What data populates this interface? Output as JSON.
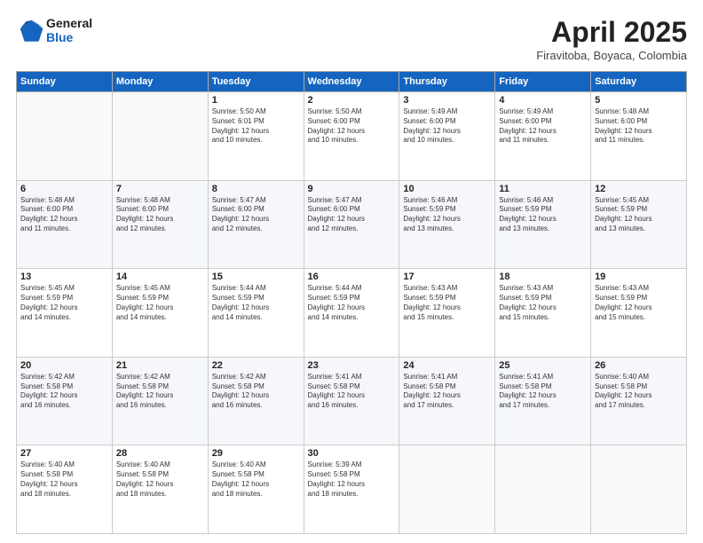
{
  "header": {
    "logo_line1": "General",
    "logo_line2": "Blue",
    "month": "April 2025",
    "location": "Firavitoba, Boyaca, Colombia"
  },
  "weekdays": [
    "Sunday",
    "Monday",
    "Tuesday",
    "Wednesday",
    "Thursday",
    "Friday",
    "Saturday"
  ],
  "weeks": [
    [
      {
        "day": "",
        "text": ""
      },
      {
        "day": "",
        "text": ""
      },
      {
        "day": "1",
        "text": "Sunrise: 5:50 AM\nSunset: 6:01 PM\nDaylight: 12 hours\nand 10 minutes."
      },
      {
        "day": "2",
        "text": "Sunrise: 5:50 AM\nSunset: 6:00 PM\nDaylight: 12 hours\nand 10 minutes."
      },
      {
        "day": "3",
        "text": "Sunrise: 5:49 AM\nSunset: 6:00 PM\nDaylight: 12 hours\nand 10 minutes."
      },
      {
        "day": "4",
        "text": "Sunrise: 5:49 AM\nSunset: 6:00 PM\nDaylight: 12 hours\nand 11 minutes."
      },
      {
        "day": "5",
        "text": "Sunrise: 5:48 AM\nSunset: 6:00 PM\nDaylight: 12 hours\nand 11 minutes."
      }
    ],
    [
      {
        "day": "6",
        "text": "Sunrise: 5:48 AM\nSunset: 6:00 PM\nDaylight: 12 hours\nand 11 minutes."
      },
      {
        "day": "7",
        "text": "Sunrise: 5:48 AM\nSunset: 6:00 PM\nDaylight: 12 hours\nand 12 minutes."
      },
      {
        "day": "8",
        "text": "Sunrise: 5:47 AM\nSunset: 6:00 PM\nDaylight: 12 hours\nand 12 minutes."
      },
      {
        "day": "9",
        "text": "Sunrise: 5:47 AM\nSunset: 6:00 PM\nDaylight: 12 hours\nand 12 minutes."
      },
      {
        "day": "10",
        "text": "Sunrise: 5:46 AM\nSunset: 5:59 PM\nDaylight: 12 hours\nand 13 minutes."
      },
      {
        "day": "11",
        "text": "Sunrise: 5:46 AM\nSunset: 5:59 PM\nDaylight: 12 hours\nand 13 minutes."
      },
      {
        "day": "12",
        "text": "Sunrise: 5:45 AM\nSunset: 5:59 PM\nDaylight: 12 hours\nand 13 minutes."
      }
    ],
    [
      {
        "day": "13",
        "text": "Sunrise: 5:45 AM\nSunset: 5:59 PM\nDaylight: 12 hours\nand 14 minutes."
      },
      {
        "day": "14",
        "text": "Sunrise: 5:45 AM\nSunset: 5:59 PM\nDaylight: 12 hours\nand 14 minutes."
      },
      {
        "day": "15",
        "text": "Sunrise: 5:44 AM\nSunset: 5:59 PM\nDaylight: 12 hours\nand 14 minutes."
      },
      {
        "day": "16",
        "text": "Sunrise: 5:44 AM\nSunset: 5:59 PM\nDaylight: 12 hours\nand 14 minutes."
      },
      {
        "day": "17",
        "text": "Sunrise: 5:43 AM\nSunset: 5:59 PM\nDaylight: 12 hours\nand 15 minutes."
      },
      {
        "day": "18",
        "text": "Sunrise: 5:43 AM\nSunset: 5:59 PM\nDaylight: 12 hours\nand 15 minutes."
      },
      {
        "day": "19",
        "text": "Sunrise: 5:43 AM\nSunset: 5:59 PM\nDaylight: 12 hours\nand 15 minutes."
      }
    ],
    [
      {
        "day": "20",
        "text": "Sunrise: 5:42 AM\nSunset: 5:58 PM\nDaylight: 12 hours\nand 16 minutes."
      },
      {
        "day": "21",
        "text": "Sunrise: 5:42 AM\nSunset: 5:58 PM\nDaylight: 12 hours\nand 16 minutes."
      },
      {
        "day": "22",
        "text": "Sunrise: 5:42 AM\nSunset: 5:58 PM\nDaylight: 12 hours\nand 16 minutes."
      },
      {
        "day": "23",
        "text": "Sunrise: 5:41 AM\nSunset: 5:58 PM\nDaylight: 12 hours\nand 16 minutes."
      },
      {
        "day": "24",
        "text": "Sunrise: 5:41 AM\nSunset: 5:58 PM\nDaylight: 12 hours\nand 17 minutes."
      },
      {
        "day": "25",
        "text": "Sunrise: 5:41 AM\nSunset: 5:58 PM\nDaylight: 12 hours\nand 17 minutes."
      },
      {
        "day": "26",
        "text": "Sunrise: 5:40 AM\nSunset: 5:58 PM\nDaylight: 12 hours\nand 17 minutes."
      }
    ],
    [
      {
        "day": "27",
        "text": "Sunrise: 5:40 AM\nSunset: 5:58 PM\nDaylight: 12 hours\nand 18 minutes."
      },
      {
        "day": "28",
        "text": "Sunrise: 5:40 AM\nSunset: 5:58 PM\nDaylight: 12 hours\nand 18 minutes."
      },
      {
        "day": "29",
        "text": "Sunrise: 5:40 AM\nSunset: 5:58 PM\nDaylight: 12 hours\nand 18 minutes."
      },
      {
        "day": "30",
        "text": "Sunrise: 5:39 AM\nSunset: 5:58 PM\nDaylight: 12 hours\nand 18 minutes."
      },
      {
        "day": "",
        "text": ""
      },
      {
        "day": "",
        "text": ""
      },
      {
        "day": "",
        "text": ""
      }
    ]
  ]
}
